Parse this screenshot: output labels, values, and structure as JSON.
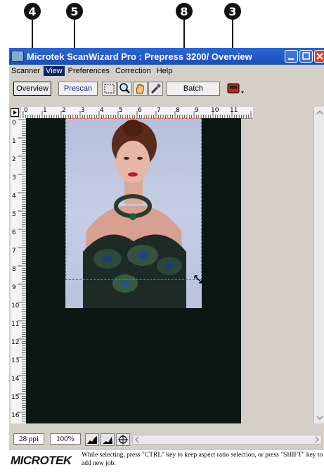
{
  "callouts": [
    "4",
    "5",
    "8",
    "3"
  ],
  "window": {
    "title": "Microtek ScanWizard Pro : Prepress 3200/ Overview"
  },
  "menu": [
    "Scanner",
    "View",
    "Preferences",
    "Correction",
    "Help"
  ],
  "menu_active": "View",
  "toolbar": {
    "overview_label": "Overview",
    "prescan_label": "Prescan",
    "batch_label": "Batch"
  },
  "ruler": {
    "h_labels": [
      "0",
      "1",
      "2",
      "3",
      "4",
      "5",
      "6",
      "7",
      "8",
      "9",
      "10",
      "11"
    ],
    "v_labels": [
      "0",
      "1",
      "2",
      "3",
      "4",
      "5",
      "6",
      "7",
      "8",
      "9",
      "10",
      "11",
      "12",
      "13",
      "14",
      "15",
      "16"
    ]
  },
  "bottom": {
    "resolution": "28 ppi",
    "zoom": "100%"
  },
  "status": {
    "logo_text": "MICROTEK",
    "message": "While selecting, press \"CTRL\" key to keep aspect ratio selection, or press \"SHIFT\" key to add new job."
  },
  "colors": {
    "titlebar": "#1c4fb8",
    "canvas": "#0c1714",
    "selection": "#d43333",
    "callout": "#111111"
  }
}
